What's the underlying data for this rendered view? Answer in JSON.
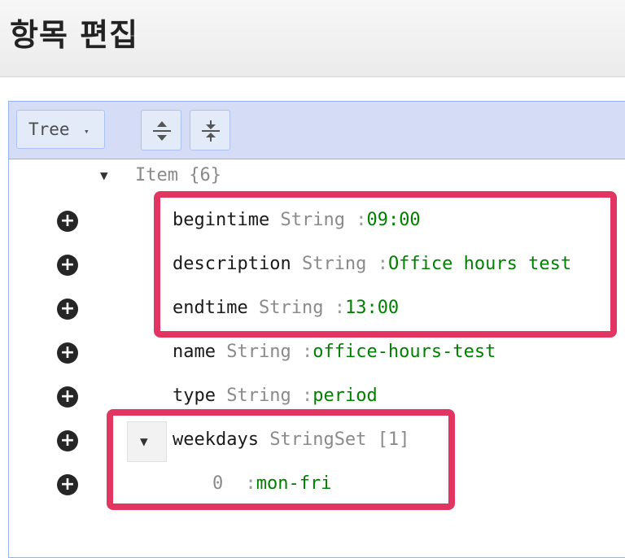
{
  "page_title": "항목 편집",
  "colors": {
    "highlight": "#e23561",
    "value": "#008000",
    "menubar": "#d5ddf6"
  },
  "menu": {
    "mode_label": "Tree",
    "mode_caret": "▾",
    "expand_all_icon": "expand-all-icon",
    "collapse_all_icon": "collapse-all-icon"
  },
  "tree": {
    "root": {
      "arrow": "▼",
      "label": "Item {6}"
    },
    "fields": [
      {
        "key": "begintime",
        "type": "String",
        "colon": ":",
        "value": "09:00"
      },
      {
        "key": "description",
        "type": "String",
        "colon": ":",
        "value": "Office hours test"
      },
      {
        "key": "endtime",
        "type": "String",
        "colon": ":",
        "value": "13:00"
      },
      {
        "key": "name",
        "type": "String",
        "colon": ":",
        "value": "office-hours-test"
      },
      {
        "key": "type",
        "type": "String",
        "colon": ":",
        "value": "period"
      },
      {
        "key": "weekdays",
        "type": "StringSet",
        "count": "[1]",
        "arrow": "▼"
      }
    ],
    "set_items": [
      {
        "index": "0",
        "colon": ":",
        "value": "mon-fri"
      }
    ]
  }
}
